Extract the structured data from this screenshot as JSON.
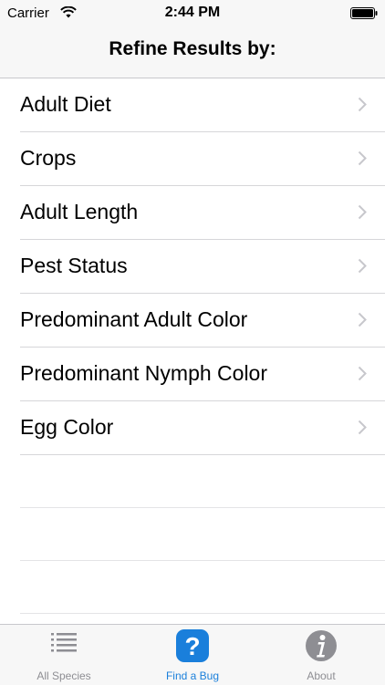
{
  "status_bar": {
    "carrier": "Carrier",
    "time": "2:44 PM"
  },
  "nav": {
    "title": "Refine Results by:"
  },
  "filters": [
    {
      "label": "Adult Diet"
    },
    {
      "label": "Crops"
    },
    {
      "label": "Adult Length"
    },
    {
      "label": "Pest Status"
    },
    {
      "label": "Predominant Adult Color"
    },
    {
      "label": "Predominant Nymph Color"
    },
    {
      "label": "Egg Color"
    }
  ],
  "tabs": [
    {
      "label": "All Species",
      "icon": "list-icon",
      "active": false
    },
    {
      "label": "Find a Bug",
      "icon": "question-icon",
      "active": true
    },
    {
      "label": "About",
      "icon": "info-icon",
      "active": false
    }
  ],
  "colors": {
    "accent": "#1a7fdb",
    "inactive": "#8e8e93",
    "bar_bg": "#f7f7f7"
  }
}
